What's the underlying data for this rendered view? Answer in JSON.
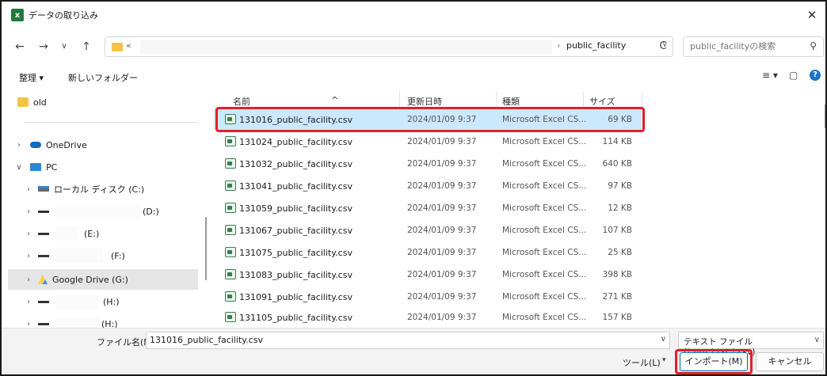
{
  "window": {
    "title": "データの取り込み",
    "app_icon_glyph": "x",
    "close_glyph": "✕"
  },
  "nav": {
    "back": "←",
    "forward": "→",
    "recent": "∨",
    "up": "↑",
    "refresh": "C",
    "address_more": "«",
    "address_separator": "›",
    "address_current": "public_facility",
    "search_placeholder": "public_facilityの検索"
  },
  "toolbar": {
    "organize_label": "整理 ▾",
    "new_folder_label": "新しいフォルダー",
    "view_glyph": "≡ ▾",
    "pane_glyph": "▢",
    "help_glyph": "?"
  },
  "sidebar": {
    "items": [
      {
        "label": "old",
        "chev": ""
      },
      {
        "label": "OneDrive",
        "chev": "›"
      },
      {
        "label": "PC",
        "chev": "∨"
      },
      {
        "label": "ローカル ディスク (C:)",
        "chev": "›"
      },
      {
        "label": "(D:)",
        "chev": "›"
      },
      {
        "label": "(E:)",
        "chev": "›"
      },
      {
        "label": "(F:)",
        "chev": "›"
      },
      {
        "label": "Google Drive (G:)",
        "chev": "›"
      },
      {
        "label": "(H:)",
        "chev": "›"
      },
      {
        "label": "(H:)",
        "chev": "›"
      }
    ]
  },
  "columns": {
    "name": "名前",
    "date": "更新日時",
    "type": "種類",
    "size": "サイズ",
    "sort_arrow": "^"
  },
  "files": [
    {
      "name": "131016_public_facility.csv",
      "date": "2024/01/09 9:37",
      "type": "Microsoft Excel CS...",
      "size": "69 KB"
    },
    {
      "name": "131024_public_facility.csv",
      "date": "2024/01/09 9:37",
      "type": "Microsoft Excel CS...",
      "size": "114 KB"
    },
    {
      "name": "131032_public_facility.csv",
      "date": "2024/01/09 9:37",
      "type": "Microsoft Excel CS...",
      "size": "640 KB"
    },
    {
      "name": "131041_public_facility.csv",
      "date": "2024/01/09 9:37",
      "type": "Microsoft Excel CS...",
      "size": "97 KB"
    },
    {
      "name": "131059_public_facility.csv",
      "date": "2024/01/09 9:37",
      "type": "Microsoft Excel CS...",
      "size": "12 KB"
    },
    {
      "name": "131067_public_facility.csv",
      "date": "2024/01/09 9:37",
      "type": "Microsoft Excel CS...",
      "size": "107 KB"
    },
    {
      "name": "131075_public_facility.csv",
      "date": "2024/01/09 9:37",
      "type": "Microsoft Excel CS...",
      "size": "25 KB"
    },
    {
      "name": "131083_public_facility.csv",
      "date": "2024/01/09 9:37",
      "type": "Microsoft Excel CS...",
      "size": "398 KB"
    },
    {
      "name": "131091_public_facility.csv",
      "date": "2024/01/09 9:37",
      "type": "Microsoft Excel CS...",
      "size": "271 KB"
    },
    {
      "name": "131105_public_facility.csv",
      "date": "2024/01/09 9:37",
      "type": "Microsoft Excel CS...",
      "size": "157 KB"
    }
  ],
  "bottom": {
    "filename_label": "ファイル名(N):",
    "filename_value": "131016_public_facility.csv",
    "filter_value": "テキスト ファイル (*.prn;*.txt;*.csv)",
    "tools_label": "ツール(L)",
    "tools_dropdown": "▾",
    "import_label": "インポート(M)",
    "cancel_label": "キャンセル",
    "dropdown_glyph": "∨"
  },
  "colors": {
    "highlight": "#e0202a",
    "selected_row": "#cce8ff",
    "excel_green": "#1f7a3f"
  }
}
